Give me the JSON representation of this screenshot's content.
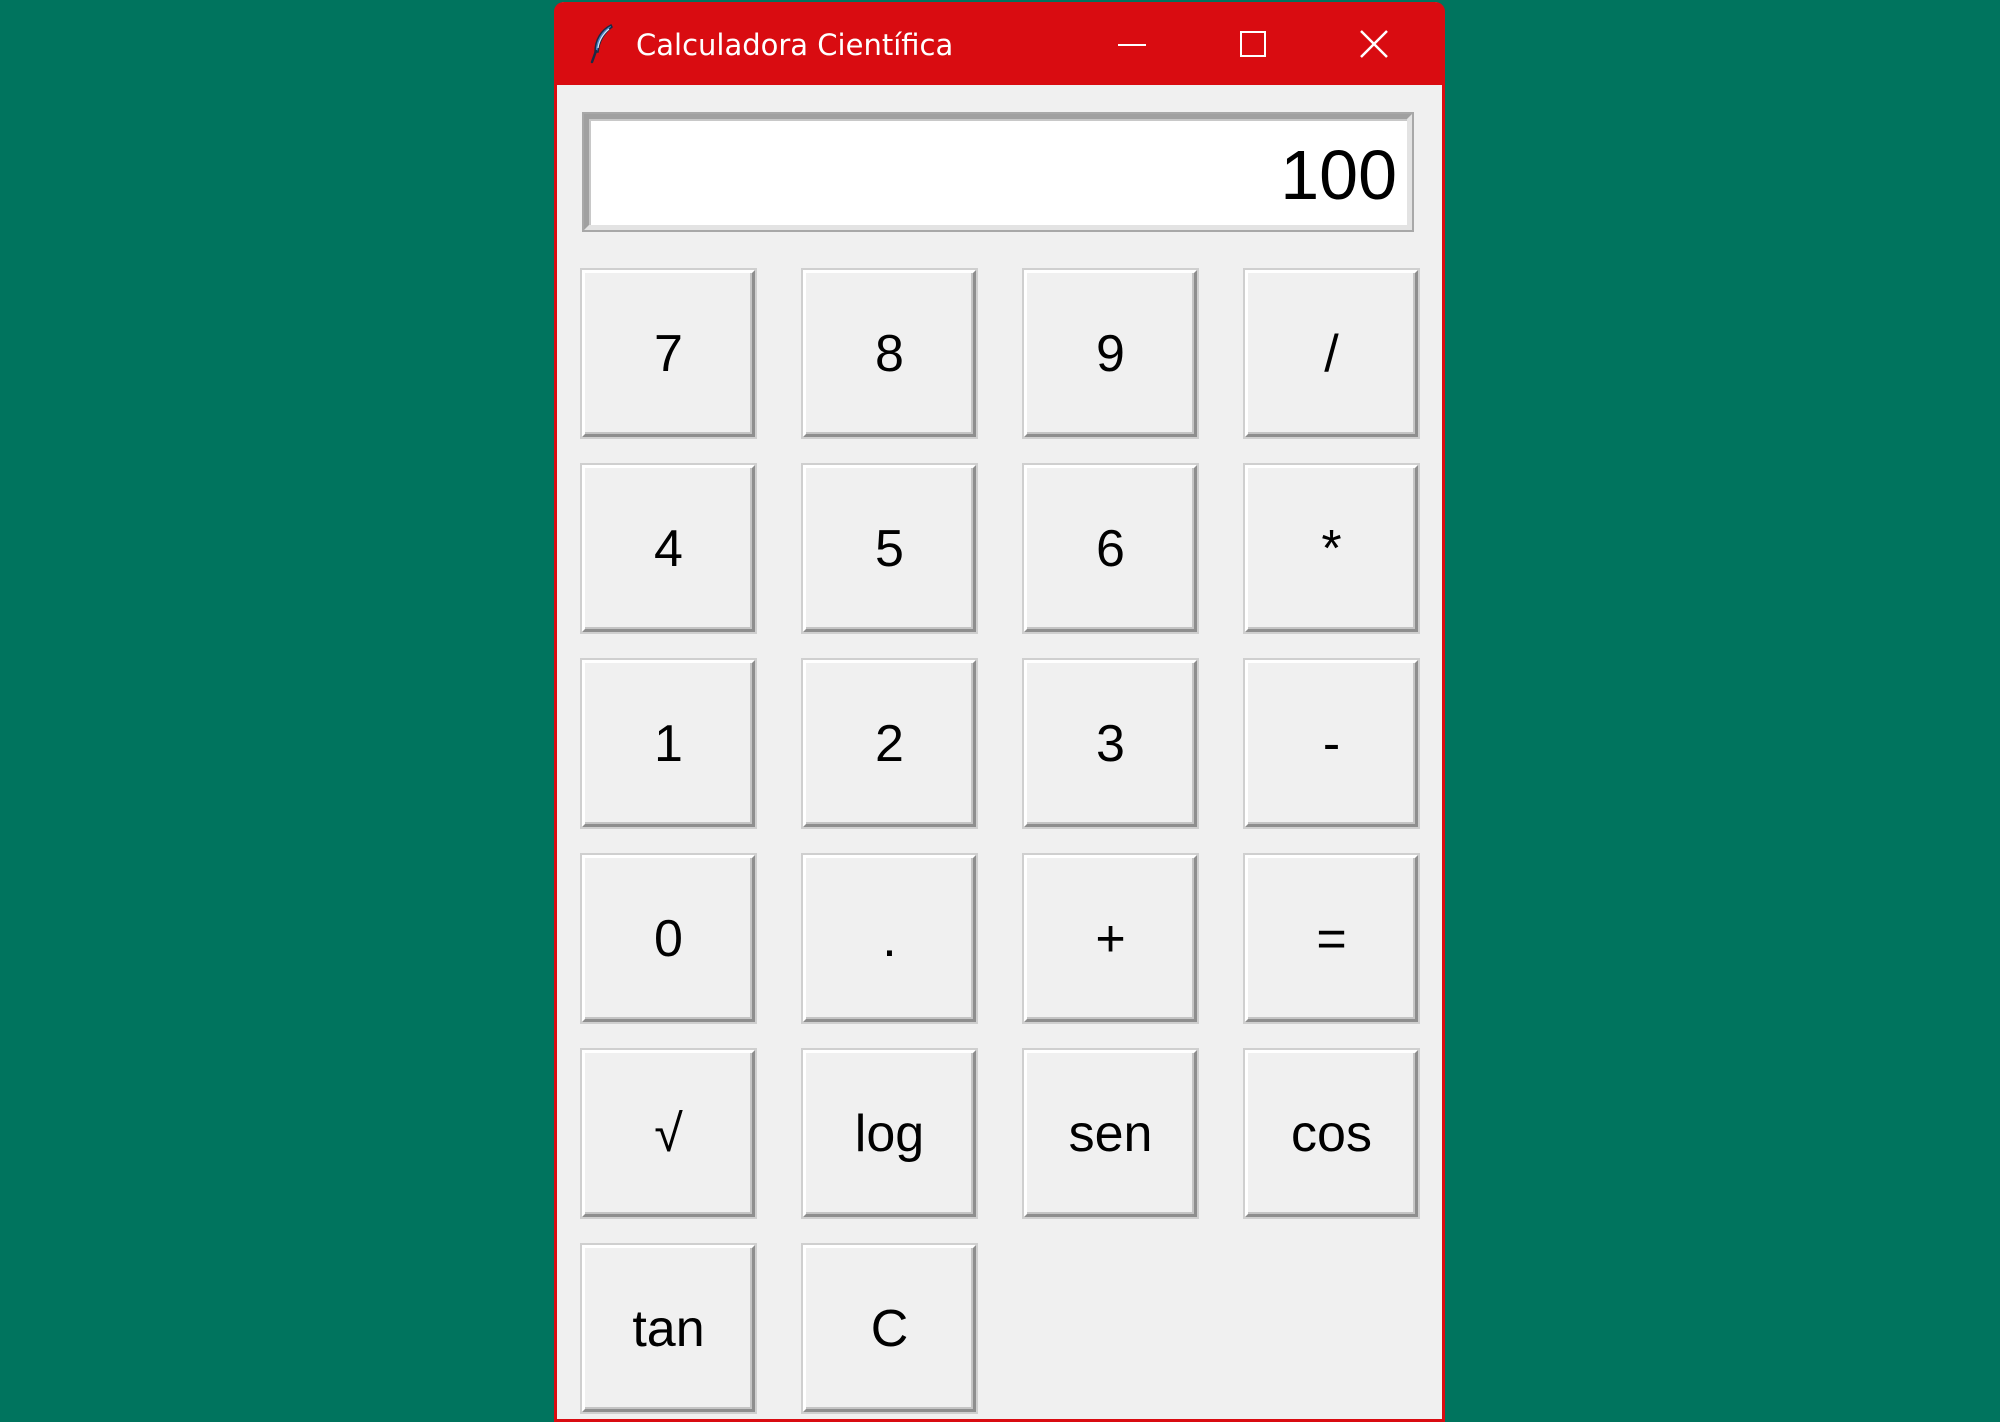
{
  "window": {
    "title": "Calculadora Científica",
    "icon": "feather-icon",
    "controls": {
      "minimize": "minimize-icon",
      "maximize": "maximize-icon",
      "close": "close-icon"
    },
    "colors": {
      "titlebar": "#d90c11",
      "background": "#f0f0f0",
      "desktop": "#00745e"
    }
  },
  "display": {
    "value": "100"
  },
  "keypad": {
    "keys": [
      {
        "label": "7",
        "name": "key-7"
      },
      {
        "label": "8",
        "name": "key-8"
      },
      {
        "label": "9",
        "name": "key-9"
      },
      {
        "label": "/",
        "name": "key-divide"
      },
      {
        "label": "4",
        "name": "key-4"
      },
      {
        "label": "5",
        "name": "key-5"
      },
      {
        "label": "6",
        "name": "key-6"
      },
      {
        "label": "*",
        "name": "key-multiply"
      },
      {
        "label": "1",
        "name": "key-1"
      },
      {
        "label": "2",
        "name": "key-2"
      },
      {
        "label": "3",
        "name": "key-3"
      },
      {
        "label": "-",
        "name": "key-subtract"
      },
      {
        "label": "0",
        "name": "key-0"
      },
      {
        "label": ".",
        "name": "key-decimal"
      },
      {
        "label": "+",
        "name": "key-add"
      },
      {
        "label": "=",
        "name": "key-equals"
      },
      {
        "label": "√",
        "name": "key-sqrt"
      },
      {
        "label": "log",
        "name": "key-log"
      },
      {
        "label": "sen",
        "name": "key-sen"
      },
      {
        "label": "cos",
        "name": "key-cos"
      },
      {
        "label": "tan",
        "name": "key-tan"
      },
      {
        "label": "C",
        "name": "key-clear"
      }
    ]
  }
}
